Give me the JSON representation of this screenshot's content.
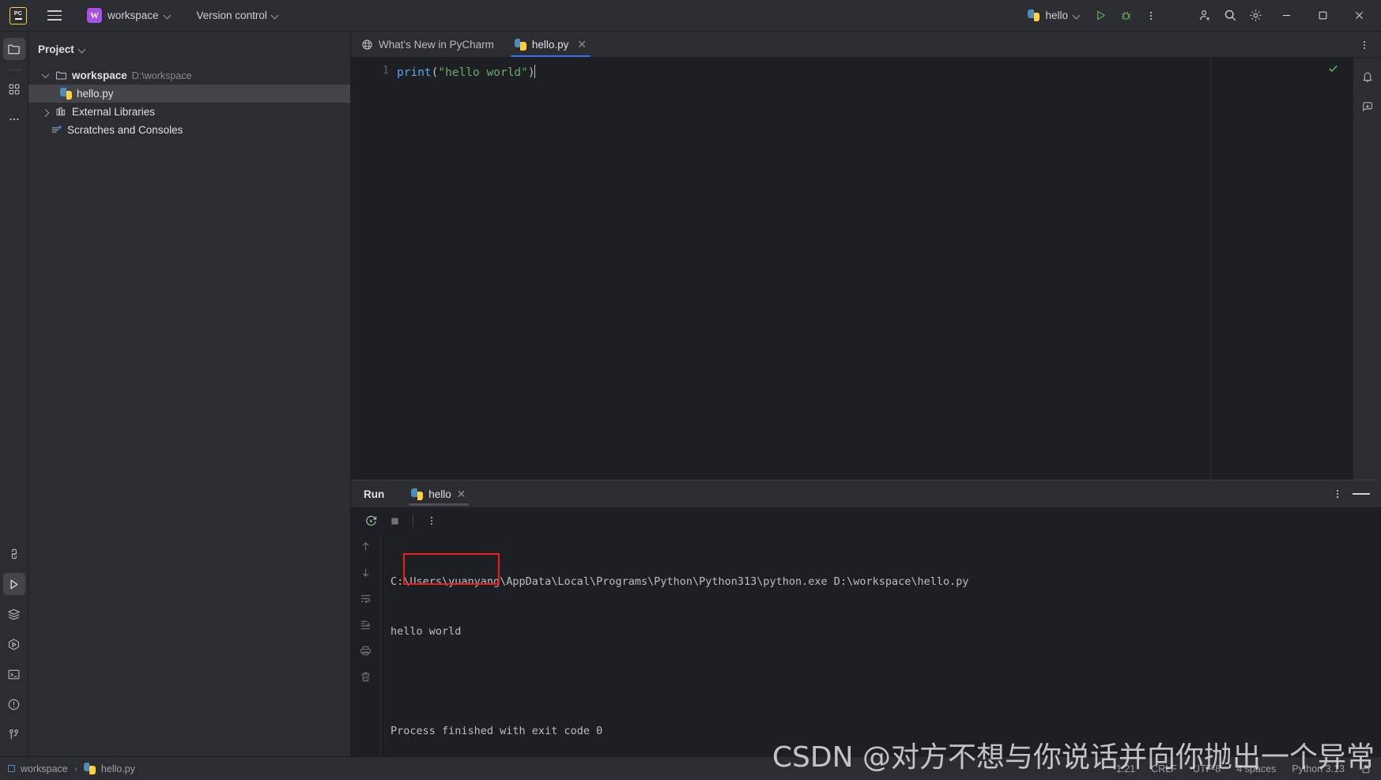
{
  "titlebar": {
    "app_icon": "pycharm-logo-icon",
    "menu_icon": "hamburger-menu-icon",
    "project_badge": "W",
    "project_name": "workspace",
    "version_control": "Version control",
    "run_config_name": "hello",
    "run_icon": "run-icon",
    "debug_icon": "debug-icon",
    "more_icon": "more-vertical-icon",
    "account_icon": "account-add-icon",
    "search_icon": "search-icon",
    "settings_icon": "settings-gear-icon",
    "minimize_icon": "window-minimize-icon",
    "maximize_icon": "window-maximize-icon",
    "close_icon": "window-close-icon"
  },
  "left_stripe": {
    "top": [
      {
        "name": "project-tool-icon",
        "label": "Project",
        "active": true
      },
      {
        "name": "commit-tool-icon",
        "label": "Commit",
        "active": false
      },
      {
        "name": "more-tool-icon",
        "label": "More tool windows",
        "active": false
      }
    ],
    "bottom": [
      {
        "name": "python-console-icon",
        "label": "Python Console",
        "active": false
      },
      {
        "name": "run-tool-icon",
        "label": "Run",
        "active": true
      },
      {
        "name": "services-icon",
        "label": "Services",
        "active": false
      },
      {
        "name": "profiler-icon",
        "label": "Profiler",
        "active": false
      },
      {
        "name": "terminal-icon",
        "label": "Terminal",
        "active": false
      },
      {
        "name": "problems-icon",
        "label": "Problems",
        "active": false
      },
      {
        "name": "version-control-icon",
        "label": "Version Control",
        "active": false
      }
    ]
  },
  "project_panel": {
    "title": "Project",
    "tree": [
      {
        "name": "workspace",
        "path": "D:\\workspace",
        "icon": "folder-icon",
        "expanded": true,
        "level": 0,
        "selected": false,
        "bold": true
      },
      {
        "name": "hello.py",
        "path": "",
        "icon": "python-file-icon",
        "expanded": null,
        "level": 1,
        "selected": true,
        "bold": false
      },
      {
        "name": "External Libraries",
        "path": "",
        "icon": "library-icon",
        "expanded": false,
        "level": 0,
        "selected": false,
        "bold": false
      },
      {
        "name": "Scratches and Consoles",
        "path": "",
        "icon": "scratches-icon",
        "expanded": null,
        "level": 0,
        "selected": false,
        "bold": false
      }
    ]
  },
  "editor": {
    "tabs": [
      {
        "label": "What's New in PyCharm",
        "icon": "globe-icon",
        "active": false,
        "closable": false
      },
      {
        "label": "hello.py",
        "icon": "python-file-icon",
        "active": true,
        "closable": true
      }
    ],
    "tabs_kebab_icon": "more-vertical-icon",
    "line_numbers": [
      "1"
    ],
    "code": {
      "func": "print",
      "open_paren": "(",
      "string": "\"hello world\"",
      "close_paren": ")"
    },
    "inspection_status_icon": "checkmark-ok-icon"
  },
  "run_panel": {
    "title": "Run",
    "tab_label": "hello",
    "tab_icon": "python-file-icon",
    "tab_close_icon": "close-icon",
    "options_icon": "more-vertical-icon",
    "hide_icon": "minimize-icon",
    "toolbar": [
      {
        "name": "rerun-button",
        "label": "Rerun",
        "icon": "rerun-icon"
      },
      {
        "name": "stop-button",
        "label": "Stop",
        "icon": "stop-square-icon"
      },
      {
        "name": "run-options-button",
        "label": "More",
        "icon": "more-vertical-icon"
      }
    ],
    "console_gutter": [
      {
        "name": "prev-occurrence-button",
        "icon": "arrow-up-icon"
      },
      {
        "name": "next-occurrence-button",
        "icon": "arrow-down-icon"
      },
      {
        "name": "soft-wrap-button",
        "icon": "soft-wrap-icon"
      },
      {
        "name": "scroll-to-end-button",
        "icon": "scroll-to-end-icon"
      },
      {
        "name": "print-button",
        "icon": "printer-icon"
      },
      {
        "name": "clear-all-button",
        "icon": "trash-icon"
      }
    ],
    "console_lines": [
      "C:\\Users\\yuanyang\\AppData\\Local\\Programs\\Python\\Python313\\python.exe D:\\workspace\\hello.py",
      "hello world",
      "",
      "Process finished with exit code 0"
    ],
    "highlight_color": "#ee1c25"
  },
  "statusbar": {
    "breadcrumb": [
      {
        "label": "workspace",
        "icon": "module-icon"
      },
      {
        "label": "hello.py",
        "icon": "python-file-icon"
      }
    ],
    "separator": "›",
    "caret_position": "1:21",
    "line_separator": "CRLF",
    "encoding": "UTF-8",
    "indent": "4 spaces",
    "interpreter": "Python 3.13",
    "lock_icon": "read-only-lock-icon"
  },
  "watermark": "CSDN @对方不想与你说话并向你抛出一个异常",
  "colors": {
    "bg_editor": "#1e1f22",
    "bg_panel": "#2b2d30",
    "accent_blue": "#3574f0",
    "string_green": "#6aab73",
    "function_blue": "#56a8f5",
    "badge_purple": "#a355e8"
  }
}
